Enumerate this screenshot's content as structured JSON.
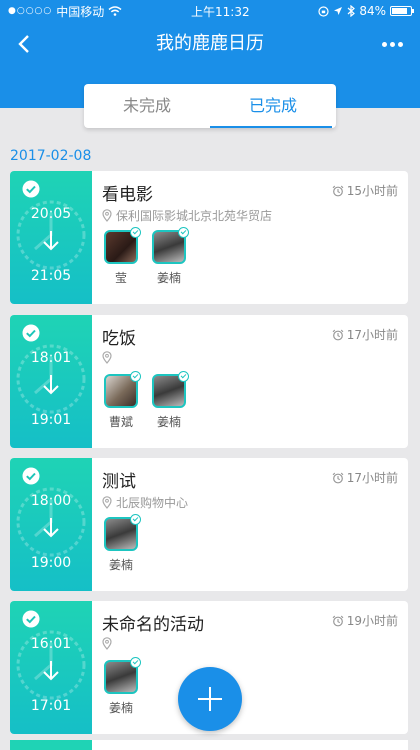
{
  "status": {
    "carrier": "中国移动",
    "time": "上午11:32",
    "battery": "84%",
    "battery_level": 0.84
  },
  "nav": {
    "title": "我的鹿鹿日历"
  },
  "tabs": [
    {
      "label": "未完成",
      "active": false
    },
    {
      "label": "已完成",
      "active": true
    }
  ],
  "date_label": "2017-02-08",
  "events": [
    {
      "title": "看电影",
      "start": "20:05",
      "end": "21:05",
      "time_ago": "15小时前",
      "location": "保利国际影城北京北苑华贸店",
      "people": [
        {
          "name": "莹",
          "avatar": "av-a"
        },
        {
          "name": "姜楠",
          "avatar": "av-b"
        }
      ]
    },
    {
      "title": "吃饭",
      "start": "18:01",
      "end": "19:01",
      "time_ago": "17小时前",
      "location": "",
      "people": [
        {
          "name": "曹斌",
          "avatar": "av-c"
        },
        {
          "name": "姜楠",
          "avatar": "av-b"
        }
      ]
    },
    {
      "title": "测试",
      "start": "18:00",
      "end": "19:00",
      "time_ago": "17小时前",
      "location": "北辰购物中心",
      "people": [
        {
          "name": "姜楠",
          "avatar": "av-b"
        }
      ]
    },
    {
      "title": "未命名的活动",
      "start": "16:01",
      "end": "17:01",
      "time_ago": "19小时前",
      "location": "",
      "people": [
        {
          "name": "姜楠",
          "avatar": "av-b"
        }
      ]
    }
  ],
  "colors": {
    "primary": "#1a8fe8",
    "accent": "#1fd3b5"
  }
}
